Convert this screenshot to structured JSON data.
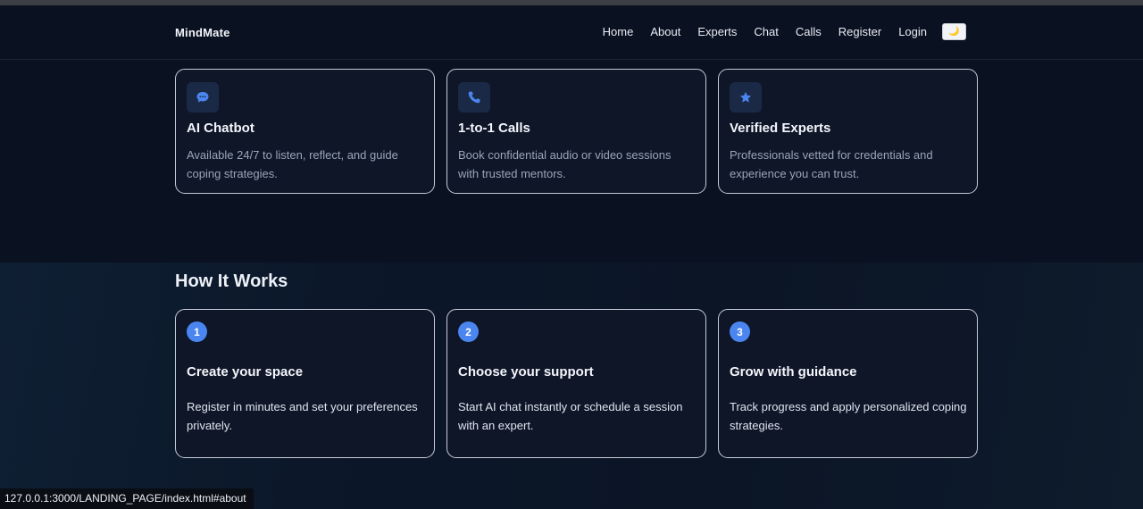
{
  "navbar": {
    "brand": "MindMate",
    "links": [
      "Home",
      "About",
      "Experts",
      "Chat",
      "Calls",
      "Register",
      "Login"
    ],
    "theme_toggle_icon": "moon-icon",
    "theme_toggle_glyph": "🌙"
  },
  "features": [
    {
      "icon": "chat-bubble-icon",
      "title": "AI Chatbot",
      "desc": "Available 24/7 to listen, reflect, and guide coping strategies."
    },
    {
      "icon": "phone-icon",
      "title": "1-to-1 Calls",
      "desc": "Book confidential audio or video sessions with trusted mentors."
    },
    {
      "icon": "star-icon",
      "title": "Verified Experts",
      "desc": "Professionals vetted for credentials and experience you can trust."
    }
  ],
  "how_it_works": {
    "title": "How It Works",
    "steps": [
      {
        "num": "1",
        "title": "Create your space",
        "desc": "Register in minutes and set your preferences privately."
      },
      {
        "num": "2",
        "title": "Choose your support",
        "desc": "Start AI chat instantly or schedule a session with an expert."
      },
      {
        "num": "3",
        "title": "Grow with guidance",
        "desc": "Track progress and apply personalized coping strategies."
      }
    ]
  },
  "status_bar": {
    "url": "127.0.0.1:3000/LANDING_PAGE/index.html#about"
  },
  "colors": {
    "accent": "#4b86f0",
    "background": "#0a1120",
    "card": "#0e1628"
  }
}
